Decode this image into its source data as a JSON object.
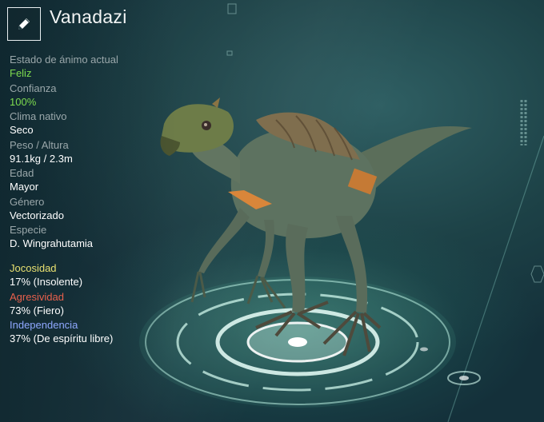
{
  "creature": {
    "name": "Vanadazi"
  },
  "edit_icon": "pencil-icon",
  "stats": [
    {
      "label": "Estado de ánimo actual",
      "value": "Feliz",
      "value_color": "#7ddb4f"
    },
    {
      "label": "Confianza",
      "value": "100%",
      "value_color": "#7ddb4f"
    },
    {
      "label": "Clima nativo",
      "value": "Seco"
    },
    {
      "label": "Peso / Altura",
      "value": "91.1kg / 2.3m"
    },
    {
      "label": "Edad",
      "value": "Mayor"
    },
    {
      "label": "Género",
      "value": "Vectorizado"
    },
    {
      "label": "Especie",
      "value": "D. Wingrahutamia"
    }
  ],
  "traits": [
    {
      "label": "Jocosidad",
      "value": "17% (Insolente)",
      "label_color": "#e8e070"
    },
    {
      "label": "Agresividad",
      "value": "73% (Fiero)",
      "label_color": "#e8604c"
    },
    {
      "label": "Independencia",
      "value": "37% (De espíritu libre)",
      "label_color": "#8fa8ff"
    }
  ]
}
